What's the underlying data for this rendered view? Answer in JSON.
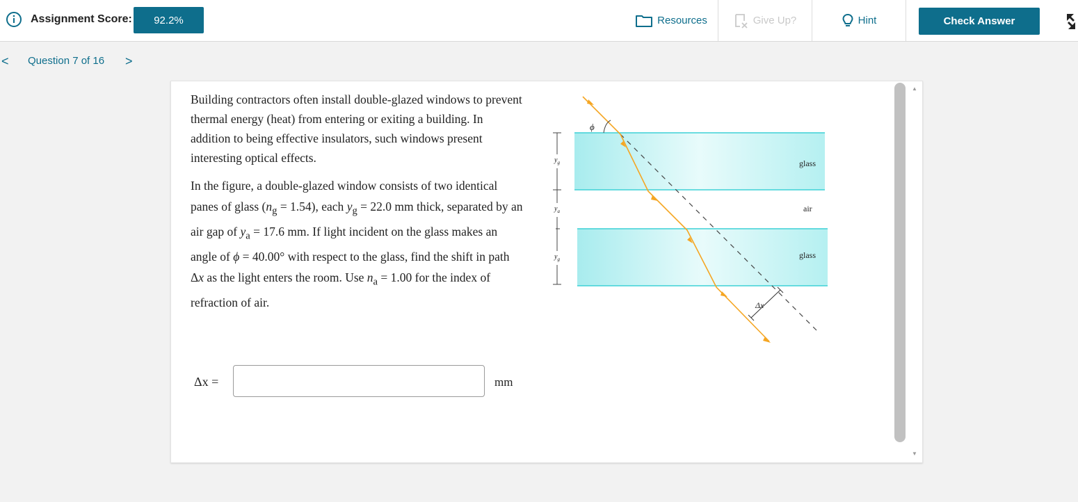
{
  "header": {
    "score_label": "Assignment Score:",
    "score_value": "92.2%",
    "resources_label": "Resources",
    "giveup_label": "Give Up?",
    "hint_label": "Hint",
    "check_label": "Check Answer"
  },
  "nav": {
    "prev_symbol": "<",
    "question_label": "Question 7 of 16",
    "next_symbol": ">"
  },
  "problem": {
    "para1": "Building contractors often install double-glazed windows to prevent thermal energy (heat) from entering or exiting a building. In addition to being effective insulators, such windows present interesting optical effects.",
    "p2_a": "In the figure, a double-glazed window consists of two identical panes of glass (",
    "ng_sym": "n",
    "ng_sub": "g",
    "p2_b": " = 1.54), each ",
    "yg_sym": "y",
    "yg_sub": "g",
    "p2_c": " = 22.0 mm thick, separated by an air gap of ",
    "ya_sym": "y",
    "ya_sub": "a",
    "p2_d": " = 17.6 mm. If light incident on the glass makes an angle of ",
    "phi_sym": "ϕ",
    "p2_e": " = 40.00° with respect to the glass, find the shift in path Δ",
    "dx_sym": "x",
    "p2_f": " as the light enters the room. Use ",
    "na_sym": "n",
    "na_sub": "a",
    "p2_g": " = 1.00 for the index of refraction of air."
  },
  "answer": {
    "label": "Δx =",
    "value": "",
    "unit": "mm"
  },
  "figure": {
    "glass_top_label": "glass",
    "air_label": "air",
    "glass_bottom_label": "glass",
    "phi_label": "ϕ",
    "dx_label": "Δx",
    "yg_top_label": "y",
    "yg_top_sub": "g",
    "ya_label": "y",
    "ya_sub": "a",
    "yg_bottom_label": "y",
    "yg_bottom_sub": "g"
  },
  "colors": {
    "accent": "#0e6e8c",
    "ray": "#f5a623",
    "glass_edge": "#3dd1d6",
    "glass_fill": "#c8f3f4",
    "disabled": "#c9c9c9"
  },
  "icons": {
    "info": "info-circle-icon",
    "resources": "folder-icon",
    "giveup": "give-up-icon",
    "hint": "lightbulb-icon",
    "fullscreen": "expand-arrows-icon"
  }
}
